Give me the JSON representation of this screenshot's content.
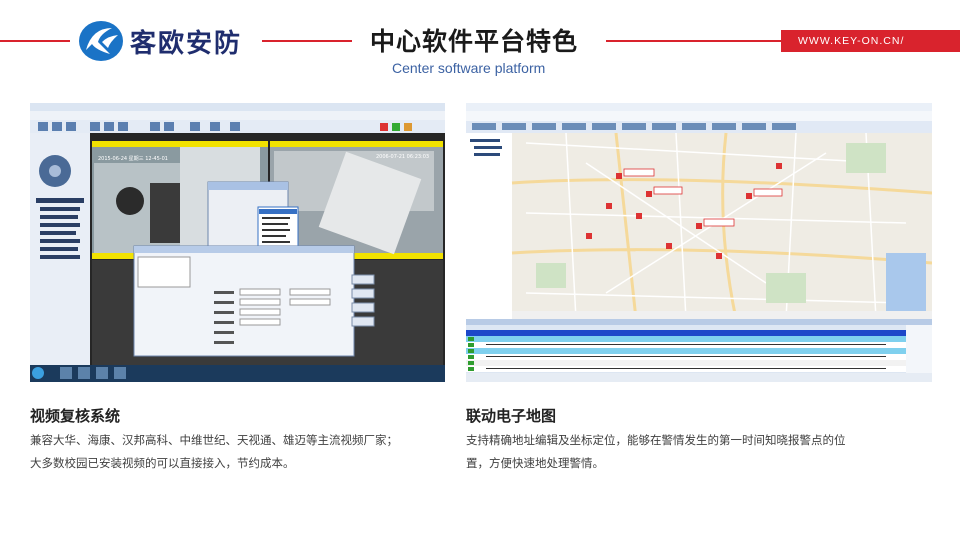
{
  "header": {
    "brand_name": "客欧安防",
    "title": "中心软件平台特色",
    "subtitle": "Center software platform",
    "website": "WWW.KEY-ON.CN/",
    "accent_color": "#d9232d",
    "brand_color": "#1f2d6e"
  },
  "features": [
    {
      "title": "视频复核系统",
      "lines": [
        "兼容大华、海康、汉邦高科、中维世纪、天视通、雄迈等主流视频厂家；",
        "大多数校园已安装视频的可以直接接入，节约成本。"
      ],
      "screenshot": {
        "camera_date": "2015-06-24 星期三 12-45-01",
        "overlay_date": "2006-07-21 06:23:03",
        "icon": "video-client-screenshot"
      }
    },
    {
      "title": "联动电子地图",
      "lines": [
        "支持精确地址编辑及坐标定位，能够在警情发生的第一时间知晓报警点的位",
        "置，方便快速地处理警情。"
      ],
      "screenshot": {
        "icon": "map-client-screenshot"
      }
    }
  ]
}
